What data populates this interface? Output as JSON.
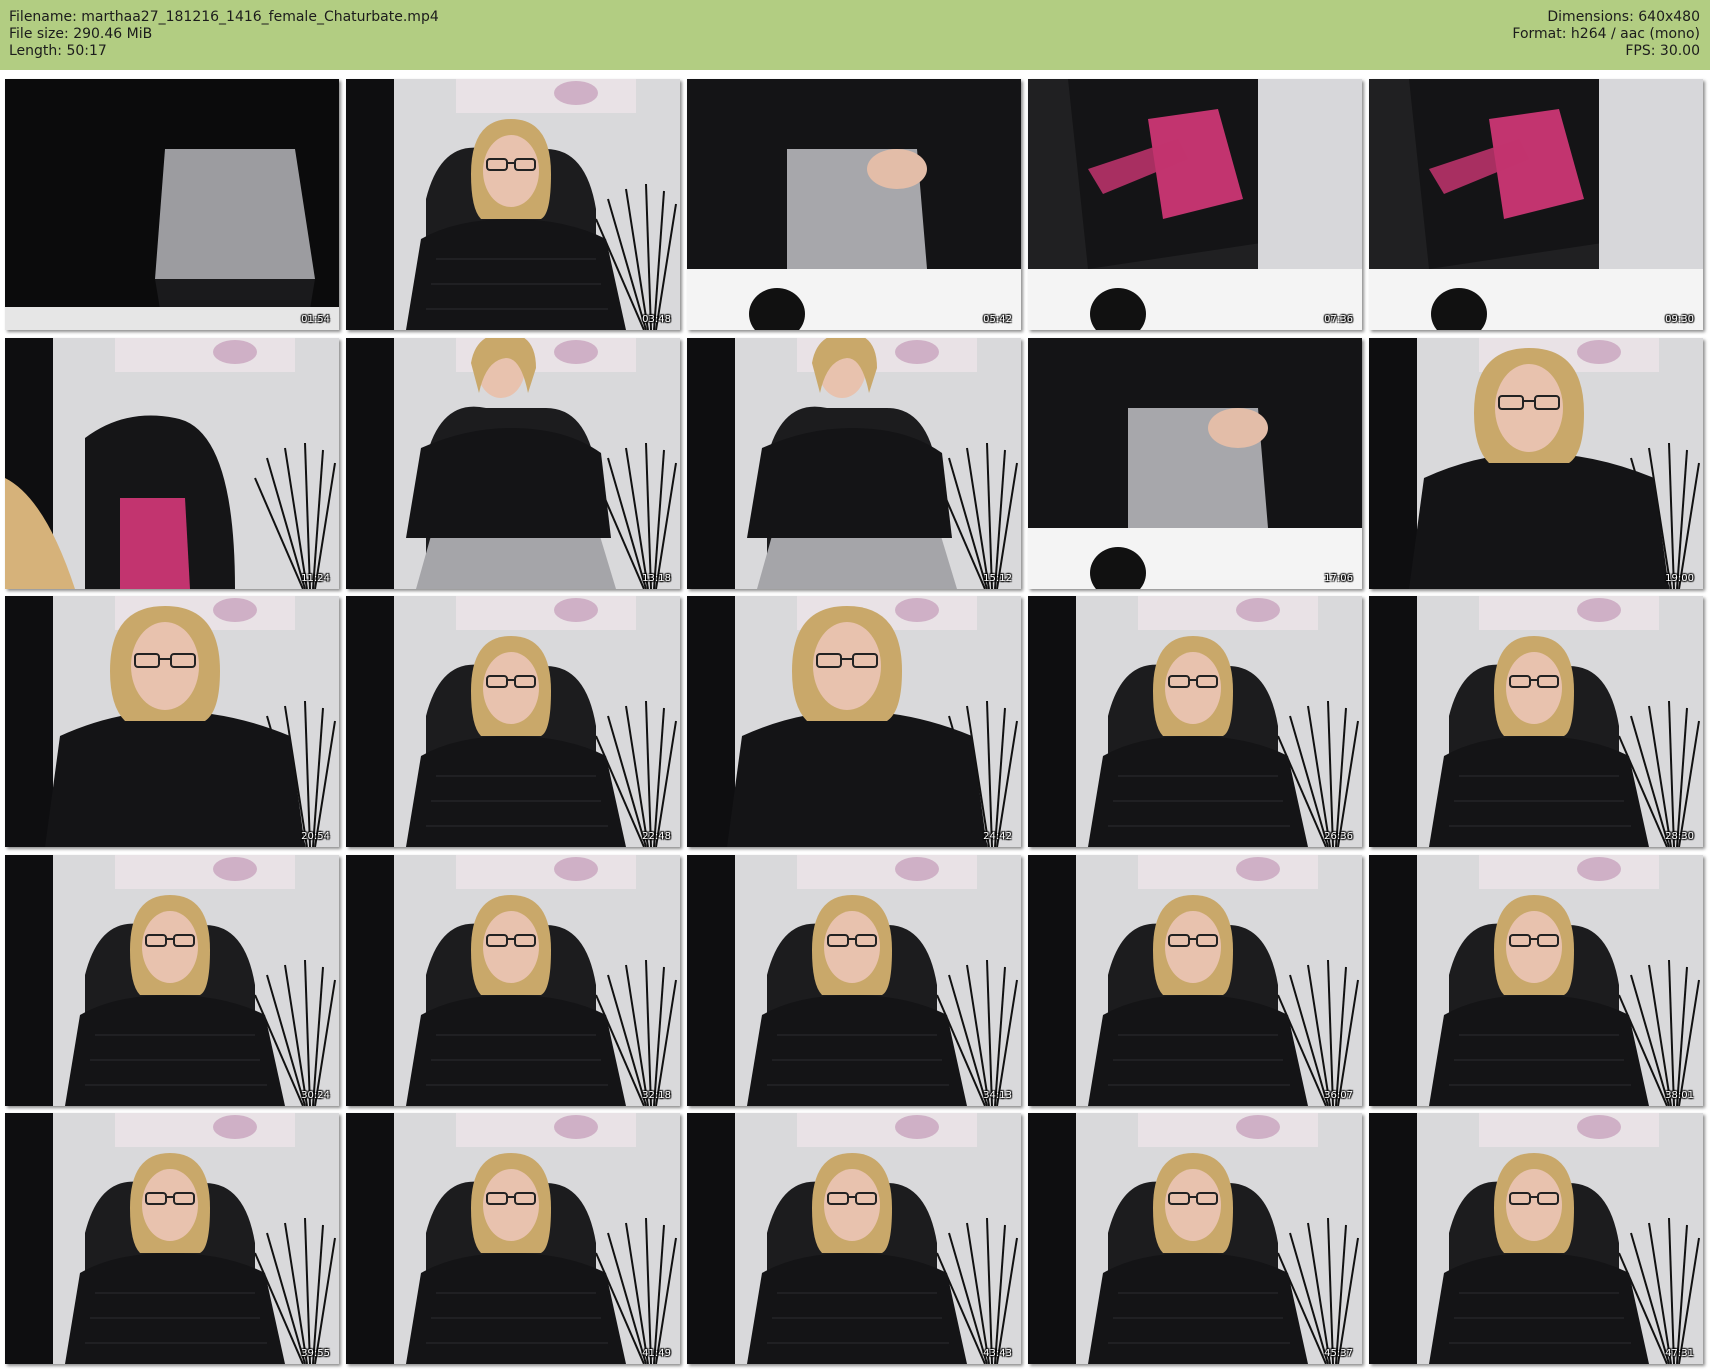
{
  "header": {
    "filename_line": "Filename: marthaa27_181216_1416_female_Chaturbate.mp4",
    "filesize_line": "File size: 290.46 MiB",
    "length_line": "Length: 50:17",
    "dimensions_line": "Dimensions: 640x480",
    "format_line": "Format: h264 / aac (mono)",
    "fps_line": "FPS: 30.00",
    "background_color": "#b2cd82"
  },
  "thumbnails": [
    {
      "timestamp": "01:54",
      "scene": "skirt"
    },
    {
      "timestamp": "03:48",
      "scene": "person"
    },
    {
      "timestamp": "05:42",
      "scene": "torso"
    },
    {
      "timestamp": "07:36",
      "scene": "chair"
    },
    {
      "timestamp": "09:30",
      "scene": "chair"
    },
    {
      "timestamp": "11:24",
      "scene": "chair-back"
    },
    {
      "timestamp": "13:18",
      "scene": "person-wide"
    },
    {
      "timestamp": "15:12",
      "scene": "person-wide"
    },
    {
      "timestamp": "17:06",
      "scene": "torso"
    },
    {
      "timestamp": "19:00",
      "scene": "person-close"
    },
    {
      "timestamp": "20:54",
      "scene": "person-close"
    },
    {
      "timestamp": "22:48",
      "scene": "person"
    },
    {
      "timestamp": "24:42",
      "scene": "person-close"
    },
    {
      "timestamp": "26:36",
      "scene": "person"
    },
    {
      "timestamp": "28:30",
      "scene": "person"
    },
    {
      "timestamp": "30:24",
      "scene": "person"
    },
    {
      "timestamp": "32:18",
      "scene": "person"
    },
    {
      "timestamp": "34:13",
      "scene": "person"
    },
    {
      "timestamp": "36:07",
      "scene": "person"
    },
    {
      "timestamp": "38:01",
      "scene": "person"
    },
    {
      "timestamp": "39:55",
      "scene": "person"
    },
    {
      "timestamp": "41:49",
      "scene": "person"
    },
    {
      "timestamp": "43:43",
      "scene": "person"
    },
    {
      "timestamp": "45:37",
      "scene": "person"
    },
    {
      "timestamp": "47:31",
      "scene": "person"
    }
  ]
}
